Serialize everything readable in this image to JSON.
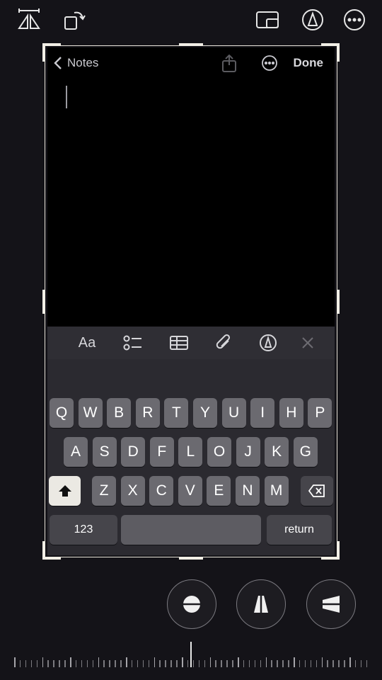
{
  "toolbar_icons": [
    "mirror-icon",
    "rotate-icon",
    "aspect-ratio-icon",
    "markup-pen-icon",
    "more-icon"
  ],
  "notes": {
    "back_label": "Notes",
    "done_label": "Done"
  },
  "format_toolbar": [
    "format-text-icon",
    "checklist-icon",
    "table-icon",
    "attachment-icon",
    "markup-icon",
    "close-icon"
  ],
  "format_text_label": "Aa",
  "keyboard": {
    "row1": [
      "Q",
      "W",
      "B",
      "R",
      "T",
      "Y",
      "U",
      "I",
      "H",
      "P"
    ],
    "row2": [
      "A",
      "S",
      "D",
      "F",
      "L",
      "O",
      "J",
      "K",
      "G"
    ],
    "row3": [
      "Z",
      "X",
      "C",
      "V",
      "E",
      "N",
      "M"
    ],
    "numbers_label": "123",
    "return_label": "return"
  },
  "bottom_controls": [
    "straighten-icon",
    "vertical-perspective-icon",
    "horizontal-perspective-icon"
  ]
}
